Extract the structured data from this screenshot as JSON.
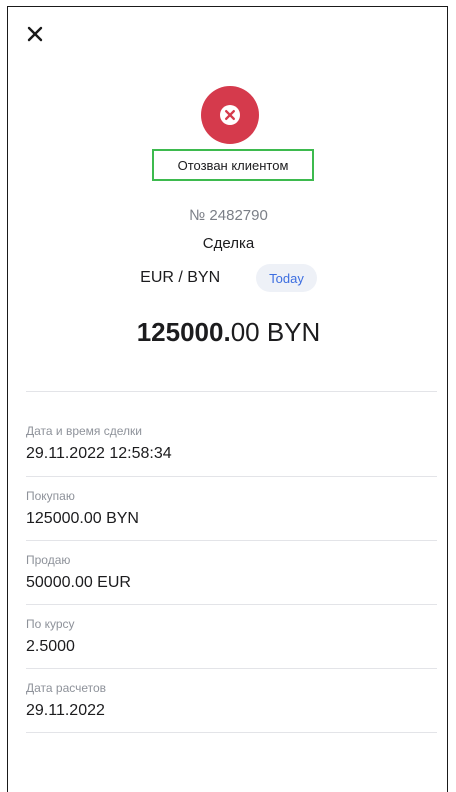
{
  "header": {
    "close_icon": "close-icon"
  },
  "status": {
    "icon": "error-x-icon",
    "color": "#d53a4c",
    "label": "Отозван клиентом"
  },
  "deal": {
    "number": "№ 2482790",
    "type": "Сделка",
    "pair": "EUR / BYN",
    "badge": "Today",
    "amount_integer": "125000.",
    "amount_fraction": "00 BYN"
  },
  "details": [
    {
      "label": "Дата и время сделки",
      "value": "29.11.2022 12:58:34"
    },
    {
      "label": "Покупаю",
      "value": "125000.00 BYN"
    },
    {
      "label": "Продаю",
      "value": "50000.00 EUR"
    },
    {
      "label": "По курсу",
      "value": "2.5000"
    },
    {
      "label": "Дата расчетов",
      "value": "29.11.2022"
    }
  ],
  "colors": {
    "accent": "#3d6ee0",
    "status_error": "#d53a4c",
    "highlight_border": "#3dba4e"
  }
}
